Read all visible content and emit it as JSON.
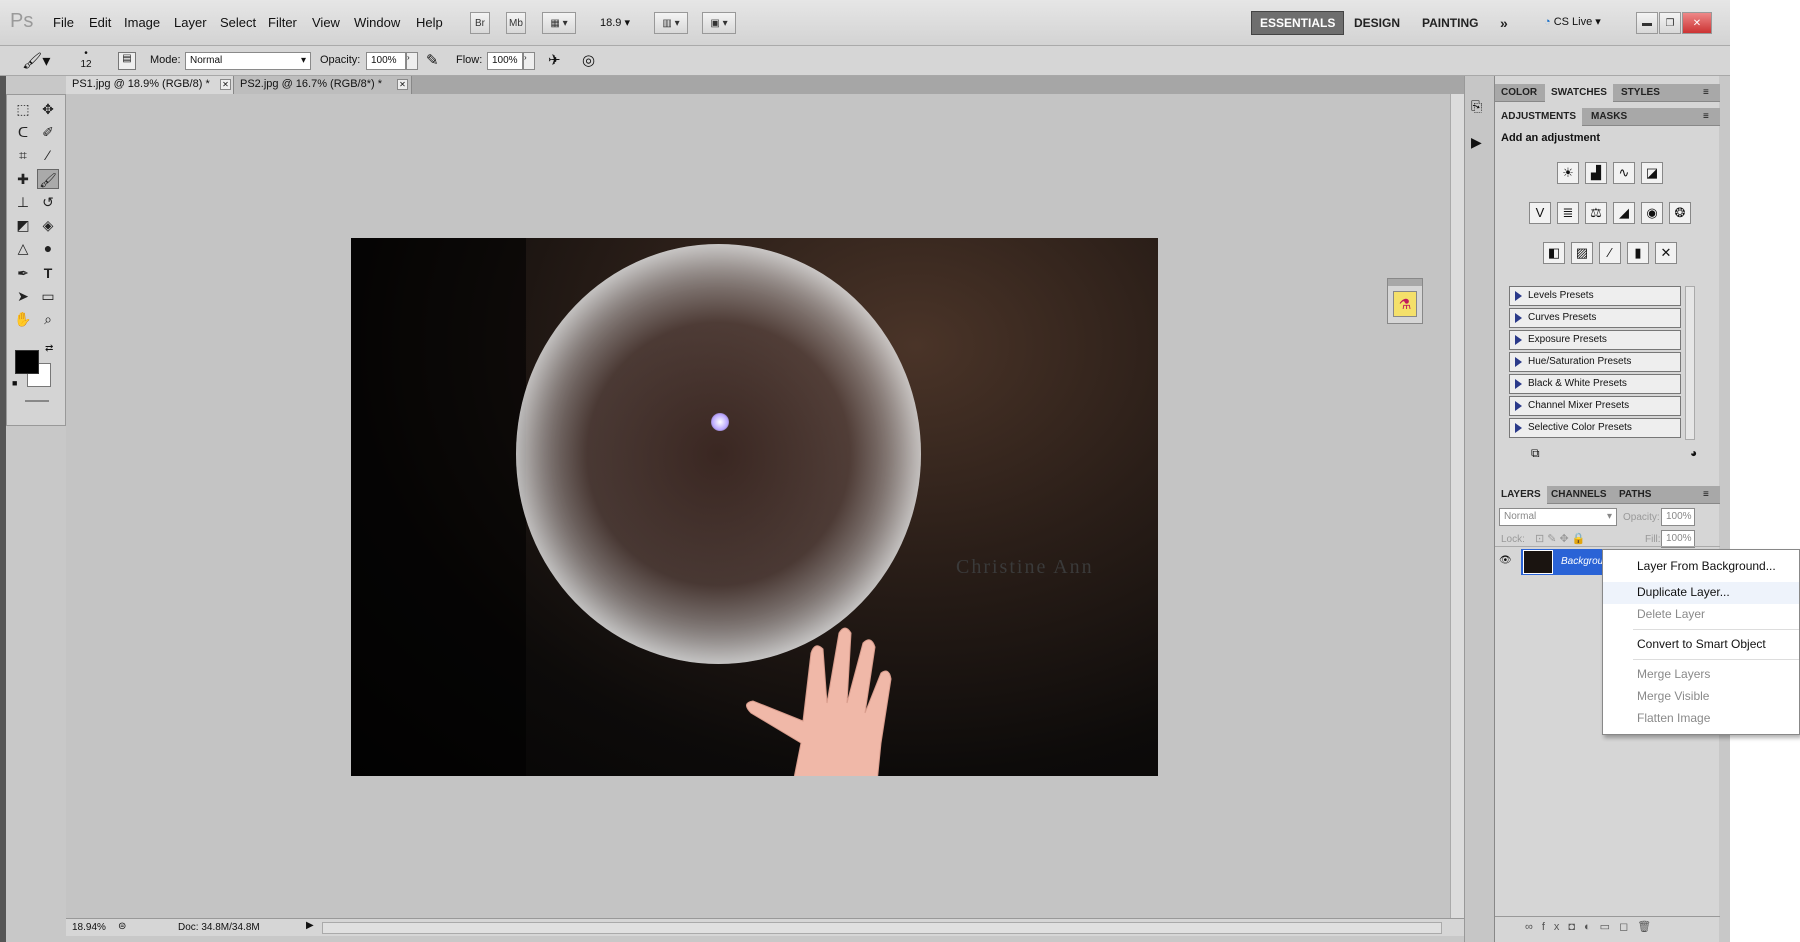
{
  "app": {
    "logo": "Ps"
  },
  "menu": [
    "File",
    "Edit",
    "Image",
    "Layer",
    "Select",
    "Filter",
    "View",
    "Window",
    "Help"
  ],
  "menubar_buttons": {
    "bridge": "Br",
    "minibridge": "Mb",
    "zoom": "18.9"
  },
  "workspaces": [
    "ESSENTIALS",
    "DESIGN",
    "PAINTING"
  ],
  "cslive": "CS Live",
  "options": {
    "brush_size": "12",
    "mode_label": "Mode:",
    "mode_value": "Normal",
    "opacity_label": "Opacity:",
    "opacity_value": "100%",
    "flow_label": "Flow:",
    "flow_value": "100%"
  },
  "tabs": [
    {
      "label": "PS1.jpg @ 18.9% (RGB/8) *"
    },
    {
      "label": "PS2.jpg @ 16.7% (RGB/8*) *"
    }
  ],
  "watermark": "Christine Ann",
  "status": {
    "zoom": "18.94%",
    "doc": "Doc: 34.8M/34.8M"
  },
  "panel_color_tabs": [
    "COLOR",
    "SWATCHES",
    "STYLES"
  ],
  "panel_adjust_tabs": [
    "ADJUSTMENTS",
    "MASKS"
  ],
  "adjust_title": "Add an adjustment",
  "presets": [
    "Levels Presets",
    "Curves Presets",
    "Exposure Presets",
    "Hue/Saturation Presets",
    "Black & White Presets",
    "Channel Mixer Presets",
    "Selective Color Presets"
  ],
  "layers_tabs": [
    "LAYERS",
    "CHANNELS",
    "PATHS"
  ],
  "layers": {
    "blend": "Normal",
    "opacity_label": "Opacity:",
    "opacity": "100%",
    "lock_label": "Lock:",
    "fill_label": "Fill:",
    "fill": "100%",
    "layer_name": "Background"
  },
  "context_menu": {
    "items": [
      {
        "label": "Layer From Background...",
        "enabled": true
      },
      {
        "label": "Duplicate Layer...",
        "enabled": true
      },
      {
        "label": "Delete Layer",
        "enabled": false
      },
      {
        "label": "Convert to Smart Object",
        "enabled": true
      },
      {
        "label": "Merge Layers",
        "enabled": false
      },
      {
        "label": "Merge Visible",
        "enabled": false
      },
      {
        "label": "Flatten Image",
        "enabled": false
      }
    ]
  }
}
